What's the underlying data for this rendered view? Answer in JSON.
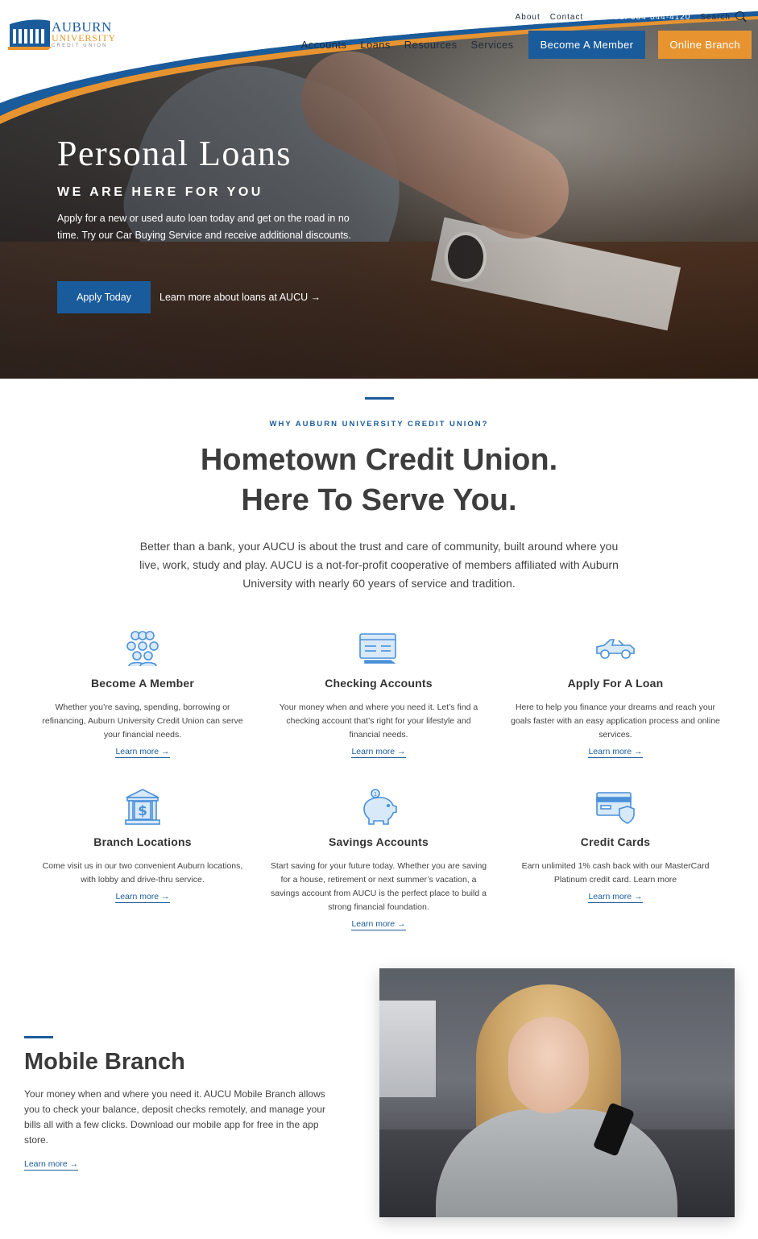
{
  "brand": {
    "line1": "AUBURN",
    "line2": "UNIVERSITY",
    "line3": "CREDIT UNION",
    "colors": {
      "blue": "#1a5b9c",
      "orange": "#e79430",
      "dark_text": "#3d3d3d"
    }
  },
  "util_nav": {
    "about": "About",
    "contact": "Contact",
    "phone": "Call Us: 334-844-4120",
    "search": "Search",
    "search_icon": "search-icon"
  },
  "main_nav": {
    "items": [
      "Accounts",
      "Loans",
      "Resources",
      "Services"
    ],
    "become_member": "Become A Member",
    "online_branch": "Online Branch"
  },
  "hero": {
    "title": "Personal Loans",
    "subtitle": "WE ARE HERE FOR YOU",
    "description": "Apply for a new or used auto loan today and get on the road in no time. Try our Car Buying Service and receive additional discounts.",
    "cta": "Apply Today",
    "link": "Learn more about loans at AUCU →"
  },
  "why": {
    "eyebrow": "WHY AUBURN UNIVERSITY CREDIT UNION?",
    "headline_line1": "Hometown Credit Union.",
    "headline_line2": "Here To Serve You.",
    "intro": "Better than a bank, your AUCU is about the trust and care of community, built around where you live, work, study and play. AUCU is a not-for-profit cooperative of members affiliated with Auburn University with nearly 60 years of service and tradition."
  },
  "features": [
    {
      "icon": "people-group-icon",
      "title": "Become A Member",
      "text": "Whether you’re saving, spending, borrowing or refinancing, Auburn University Credit Union can serve your financial needs.",
      "link": "Learn more →"
    },
    {
      "icon": "checking-card-icon",
      "title": "Checking Accounts",
      "text": "Your money when and where you need it. Let’s find a checking account that’s right for your lifestyle and financial needs.",
      "link": "Learn more →"
    },
    {
      "icon": "car-icon",
      "title": "Apply For A Loan",
      "text": "Here to help you finance your dreams and reach your goals faster with an easy application process and online services.",
      "link": "Learn more →"
    },
    {
      "icon": "bank-dollar-icon",
      "title": "Branch Locations",
      "text": "Come visit us in our two convenient Auburn locations, with lobby and drive-thru service.",
      "link": "Learn more →"
    },
    {
      "icon": "piggy-bank-icon",
      "title": "Savings Accounts",
      "text": "Start saving for your future today. Whether you are saving for a house, retirement or next summer’s vacation, a savings account from AUCU is the perfect place to build a strong financial foundation.",
      "link": "Learn more →"
    },
    {
      "icon": "credit-card-shield-icon",
      "title": "Credit Cards",
      "text": "Earn unlimited 1% cash back with our MasterCard Platinum credit card. Learn more",
      "link": "Learn more →"
    }
  ],
  "mobile": {
    "title": "Mobile Branch",
    "description": "Your money when and where you need it. AUCU Mobile Branch allows you to check your balance, deposit checks remotely, and manage your bills all with a few clicks. Download our mobile app for free in the app store.",
    "link": "Learn more →"
  }
}
